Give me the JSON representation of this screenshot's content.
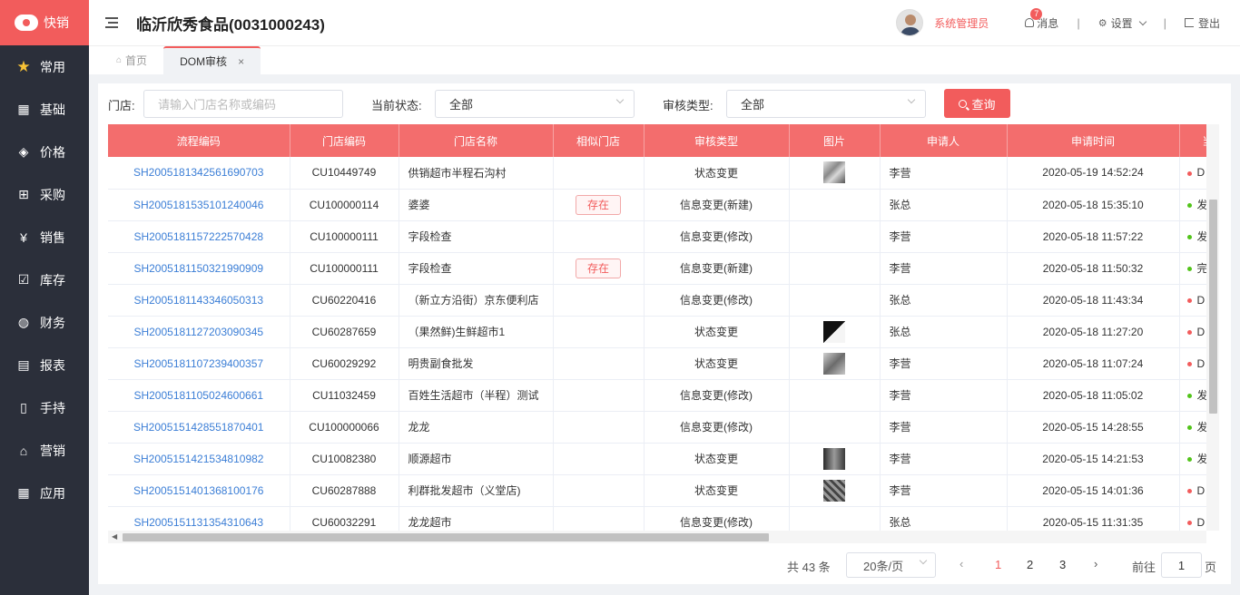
{
  "app": {
    "logo_text": "快销"
  },
  "sidebar": {
    "items": [
      {
        "label": "常用"
      },
      {
        "label": "基础"
      },
      {
        "label": "价格"
      },
      {
        "label": "采购"
      },
      {
        "label": "销售"
      },
      {
        "label": "库存"
      },
      {
        "label": "财务"
      },
      {
        "label": "报表"
      },
      {
        "label": "手持"
      },
      {
        "label": "营销"
      },
      {
        "label": "应用"
      }
    ]
  },
  "header": {
    "store_title": "临沂欣秀食品(0031000243)",
    "user_name": "系统管理员",
    "message_badge": "7",
    "message_label": "消息",
    "settings_label": "设置",
    "logout_label": "登出",
    "separator": "|"
  },
  "tabs": {
    "home": "首页",
    "active": "DOM审核",
    "close": "×"
  },
  "filters": {
    "store_label": "门店:",
    "store_placeholder": "请输入门店名称或编码",
    "status_label": "当前状态:",
    "status_value": "全部",
    "type_label": "审核类型:",
    "type_value": "全部",
    "query_label": "查询"
  },
  "table": {
    "columns": [
      "流程编码",
      "门店编码",
      "门店名称",
      "相似门店",
      "审核类型",
      "图片",
      "申请人",
      "申请时间",
      "当"
    ],
    "rows": [
      {
        "code": "SH2005181342561690703",
        "store_code": "CU10449749",
        "store_name": "供销超市半程石沟村",
        "similar": "",
        "type": "状态变更",
        "img": "t1",
        "applicant": "李营",
        "time": "2020-05-19 14:52:24",
        "status": "D",
        "status_color": "#f25c5c"
      },
      {
        "code": "SH2005181535101240046",
        "store_code": "CU100000114",
        "store_name": "婆婆",
        "similar": "存在",
        "type": "信息变更(新建)",
        "img": "",
        "applicant": "张总",
        "time": "2020-05-18 15:35:10",
        "status": "发",
        "status_color": "#52c41a"
      },
      {
        "code": "SH2005181157222570428",
        "store_code": "CU100000111",
        "store_name": "字段检查",
        "similar": "",
        "type": "信息变更(修改)",
        "img": "",
        "applicant": "李营",
        "time": "2020-05-18 11:57:22",
        "status": "发",
        "status_color": "#52c41a"
      },
      {
        "code": "SH2005181150321990909",
        "store_code": "CU100000111",
        "store_name": "字段检查",
        "similar": "存在",
        "type": "信息变更(新建)",
        "img": "",
        "applicant": "李营",
        "time": "2020-05-18 11:50:32",
        "status": "完",
        "status_color": "#52c41a"
      },
      {
        "code": "SH2005181143346050313",
        "store_code": "CU60220416",
        "store_name": "（新立方沿街）京东便利店",
        "similar": "",
        "type": "信息变更(修改)",
        "img": "",
        "applicant": "张总",
        "time": "2020-05-18 11:43:34",
        "status": "D",
        "status_color": "#f25c5c"
      },
      {
        "code": "SH2005181127203090345",
        "store_code": "CU60287659",
        "store_name": "（果然鲜)生鲜超市1",
        "similar": "",
        "type": "状态变更",
        "img": "t2",
        "applicant": "张总",
        "time": "2020-05-18 11:27:20",
        "status": "D",
        "status_color": "#f25c5c"
      },
      {
        "code": "SH2005181107239400357",
        "store_code": "CU60029292",
        "store_name": "明贵副食批发",
        "similar": "",
        "type": "状态变更",
        "img": "t3",
        "applicant": "李营",
        "time": "2020-05-18 11:07:24",
        "status": "D",
        "status_color": "#f25c5c"
      },
      {
        "code": "SH2005181105024600661",
        "store_code": "CU11032459",
        "store_name": "百姓生活超市（半程）测试",
        "similar": "",
        "type": "信息变更(修改)",
        "img": "",
        "applicant": "李营",
        "time": "2020-05-18 11:05:02",
        "status": "发",
        "status_color": "#52c41a"
      },
      {
        "code": "SH2005151428551870401",
        "store_code": "CU100000066",
        "store_name": "龙龙",
        "similar": "",
        "type": "信息变更(修改)",
        "img": "",
        "applicant": "李营",
        "time": "2020-05-15 14:28:55",
        "status": "发",
        "status_color": "#52c41a"
      },
      {
        "code": "SH2005151421534810982",
        "store_code": "CU10082380",
        "store_name": "顺源超市",
        "similar": "",
        "type": "状态变更",
        "img": "t4",
        "applicant": "李营",
        "time": "2020-05-15 14:21:53",
        "status": "发",
        "status_color": "#52c41a"
      },
      {
        "code": "SH2005151401368100176",
        "store_code": "CU60287888",
        "store_name": "利群批发超市（义堂店)",
        "similar": "",
        "type": "状态变更",
        "img": "t5",
        "applicant": "李营",
        "time": "2020-05-15 14:01:36",
        "status": "D",
        "status_color": "#f25c5c"
      },
      {
        "code": "SH2005151131354310643",
        "store_code": "CU60032291",
        "store_name": "龙龙超市",
        "similar": "",
        "type": "信息变更(修改)",
        "img": "",
        "applicant": "张总",
        "time": "2020-05-15 11:31:35",
        "status": "D",
        "status_color": "#f25c5c"
      }
    ]
  },
  "pagination": {
    "total": "共 43 条",
    "page_size": "20条/页",
    "pages": [
      "1",
      "2",
      "3"
    ],
    "current_page": "1",
    "goto_label": "前往",
    "goto_value": "1",
    "goto_suffix": "页",
    "prev": "‹",
    "next": "›"
  },
  "colors": {
    "accent": "#f25c5c",
    "header_row": "#f36d6d",
    "sidebar": "#2b2f3a",
    "link": "#3b7ed6"
  }
}
